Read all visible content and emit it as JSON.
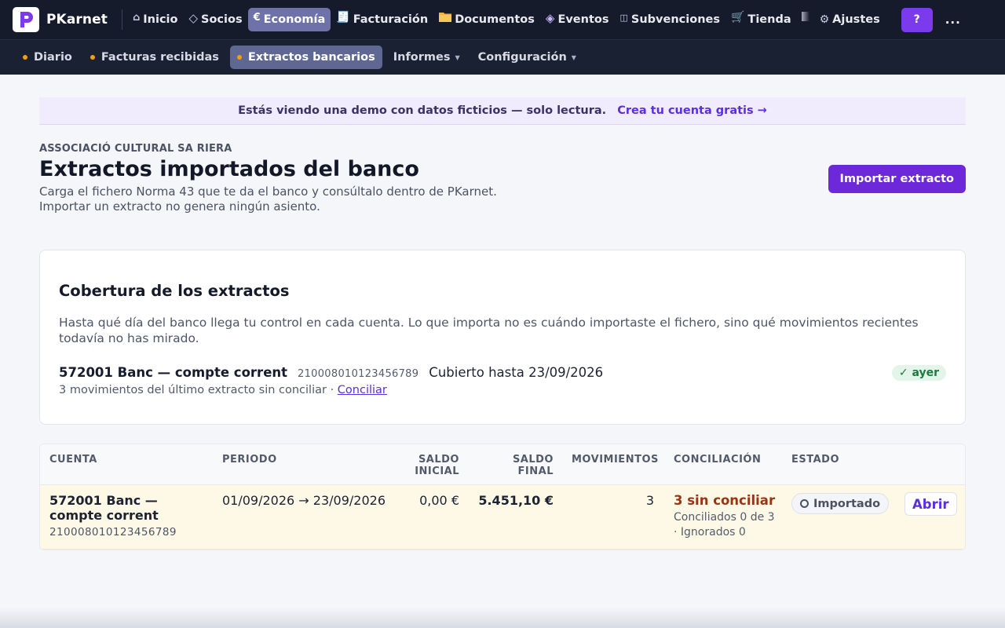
{
  "app": {
    "name": "PKarnet"
  },
  "topnav": {
    "items": [
      {
        "label": "Inicio",
        "icon": "home-icon"
      },
      {
        "label": "Socios",
        "icon": "diamond-icon"
      },
      {
        "label": "Economía",
        "icon": "euro-icon",
        "active": true
      },
      {
        "label": "Facturación",
        "icon": "receipt-icon"
      },
      {
        "label": "Documentos",
        "icon": "folder-icon"
      },
      {
        "label": "Eventos",
        "icon": "event-diamond-icon"
      },
      {
        "label": "Subvenciones",
        "icon": "columns-icon"
      },
      {
        "label": "Tienda",
        "icon": "cart-icon"
      },
      {
        "label": "Ajustes",
        "icon": "gear-icon"
      }
    ],
    "help_label": "?",
    "more_label": "..."
  },
  "subnav": {
    "items": [
      {
        "label": "Diario",
        "dot": true
      },
      {
        "label": "Facturas recibidas",
        "dot": true
      },
      {
        "label": "Extractos bancarios",
        "dot": true,
        "active": true
      },
      {
        "label": "Informes",
        "dropdown": true
      },
      {
        "label": "Configuración",
        "dropdown": true
      }
    ]
  },
  "banner": {
    "text": "Estás viendo una demo con datos ficticios — solo lectura.",
    "link": "Crea tu cuenta gratis →"
  },
  "header": {
    "org": "ASSOCIACIÓ CULTURAL SA RIERA",
    "title": "Extractos importados del banco",
    "desc_line1": "Carga el fichero Norma 43 que te da el banco y consúltalo dentro de PKarnet.",
    "desc_line2": "Importar un extracto no genera ningún asiento.",
    "import_button": "Importar extracto"
  },
  "coverage": {
    "title": "Cobertura de los extractos",
    "desc": "Hasta qué día del banco llega tu control en cada cuenta. Lo que importa no es cuándo importaste el fichero, sino qué movimientos recientes todavía no has mirado.",
    "account_name": "572001 Banc — compte corrent",
    "account_iban": "210008010123456789",
    "covered_until": "Cubierto hasta 23/09/2026",
    "freshness": "✓ ayer",
    "pending_text": "3 movimientos del último extracto sin conciliar · ",
    "reconcile_link": "Conciliar"
  },
  "table": {
    "headers": {
      "cuenta": "CUENTA",
      "periodo": "PERIODO",
      "saldo_inicial_1": "SALDO",
      "saldo_inicial_2": "INICIAL",
      "saldo_final_1": "SALDO",
      "saldo_final_2": "FINAL",
      "movimientos": "MOVIMIENTOS",
      "conciliacion": "CONCILIACIÓN",
      "estado": "ESTADO"
    },
    "rows": [
      {
        "cuenta_l1": "572001 Banc —",
        "cuenta_l2": "compte corrent",
        "iban": "210008010123456789",
        "periodo": "01/09/2026 → 23/09/2026",
        "saldo_inicial": "0,00 €",
        "saldo_final": "5.451,10 €",
        "movimientos": "3",
        "conciliacion_main": "3 sin conciliar",
        "conciliacion_sub": "Conciliados 0 de 3 · Ignorados 0",
        "estado": "Importado",
        "action": "Abrir"
      }
    ]
  },
  "colors": {
    "accent": "#6d28d9",
    "nav_bg": "#151b2b",
    "warning": "#9a3412",
    "success": "#1f7a3f"
  }
}
